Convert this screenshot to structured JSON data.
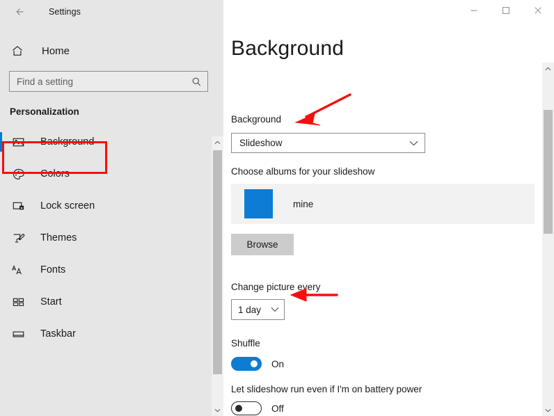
{
  "window": {
    "app_title": "Settings",
    "back_icon": "back-arrow-icon",
    "controls": [
      {
        "name": "minimize",
        "glyph": "minimize-icon"
      },
      {
        "name": "maximize",
        "glyph": "maximize-icon"
      },
      {
        "name": "close",
        "glyph": "close-icon"
      }
    ]
  },
  "sidebar": {
    "home": {
      "label": "Home",
      "icon": "home-icon"
    },
    "search": {
      "placeholder": "Find a setting",
      "value": "",
      "icon": "search-icon"
    },
    "section_header": "Personalization",
    "items": [
      {
        "label": "Background",
        "icon": "picture-icon",
        "selected": true
      },
      {
        "label": "Colors",
        "icon": "palette-icon",
        "selected": false
      },
      {
        "label": "Lock screen",
        "icon": "lock-screen-icon",
        "selected": false
      },
      {
        "label": "Themes",
        "icon": "brush-icon",
        "selected": false
      },
      {
        "label": "Fonts",
        "icon": "fonts-aa-icon",
        "selected": false
      },
      {
        "label": "Start",
        "icon": "start-tiles-icon",
        "selected": false
      },
      {
        "label": "Taskbar",
        "icon": "taskbar-icon",
        "selected": false
      }
    ],
    "scrollbar": {
      "up_icon": "chevron-up-icon",
      "down_icon": "chevron-down-icon"
    }
  },
  "main": {
    "page_title": "Background",
    "background_label": "Background",
    "background_value": "Slideshow",
    "albums_label": "Choose albums for your slideshow",
    "album": {
      "name": "mine",
      "swatch_color": "#0c7cd5"
    },
    "browse_label": "Browse",
    "interval_label": "Change picture every",
    "interval_value": "1 day",
    "shuffle_label": "Shuffle",
    "shuffle_state": "On",
    "battery_label": "Let slideshow run even if I'm on battery power",
    "battery_state": "Off",
    "chevron_icon": "chevron-down-icon",
    "scrollbar": {
      "up_icon": "chevron-up-icon",
      "down_icon": "chevron-down-icon"
    }
  },
  "annotations": {
    "accent_color": "#fb0d0d",
    "box_target": "Background",
    "arrow1_target": "Slideshow",
    "arrow2_target": "1 day"
  },
  "theme": {
    "accent": "#0078d7",
    "sidebar_bg": "#e6e6e6",
    "panel_bg": "#f2f2f2",
    "button_bg": "#cccccc"
  }
}
